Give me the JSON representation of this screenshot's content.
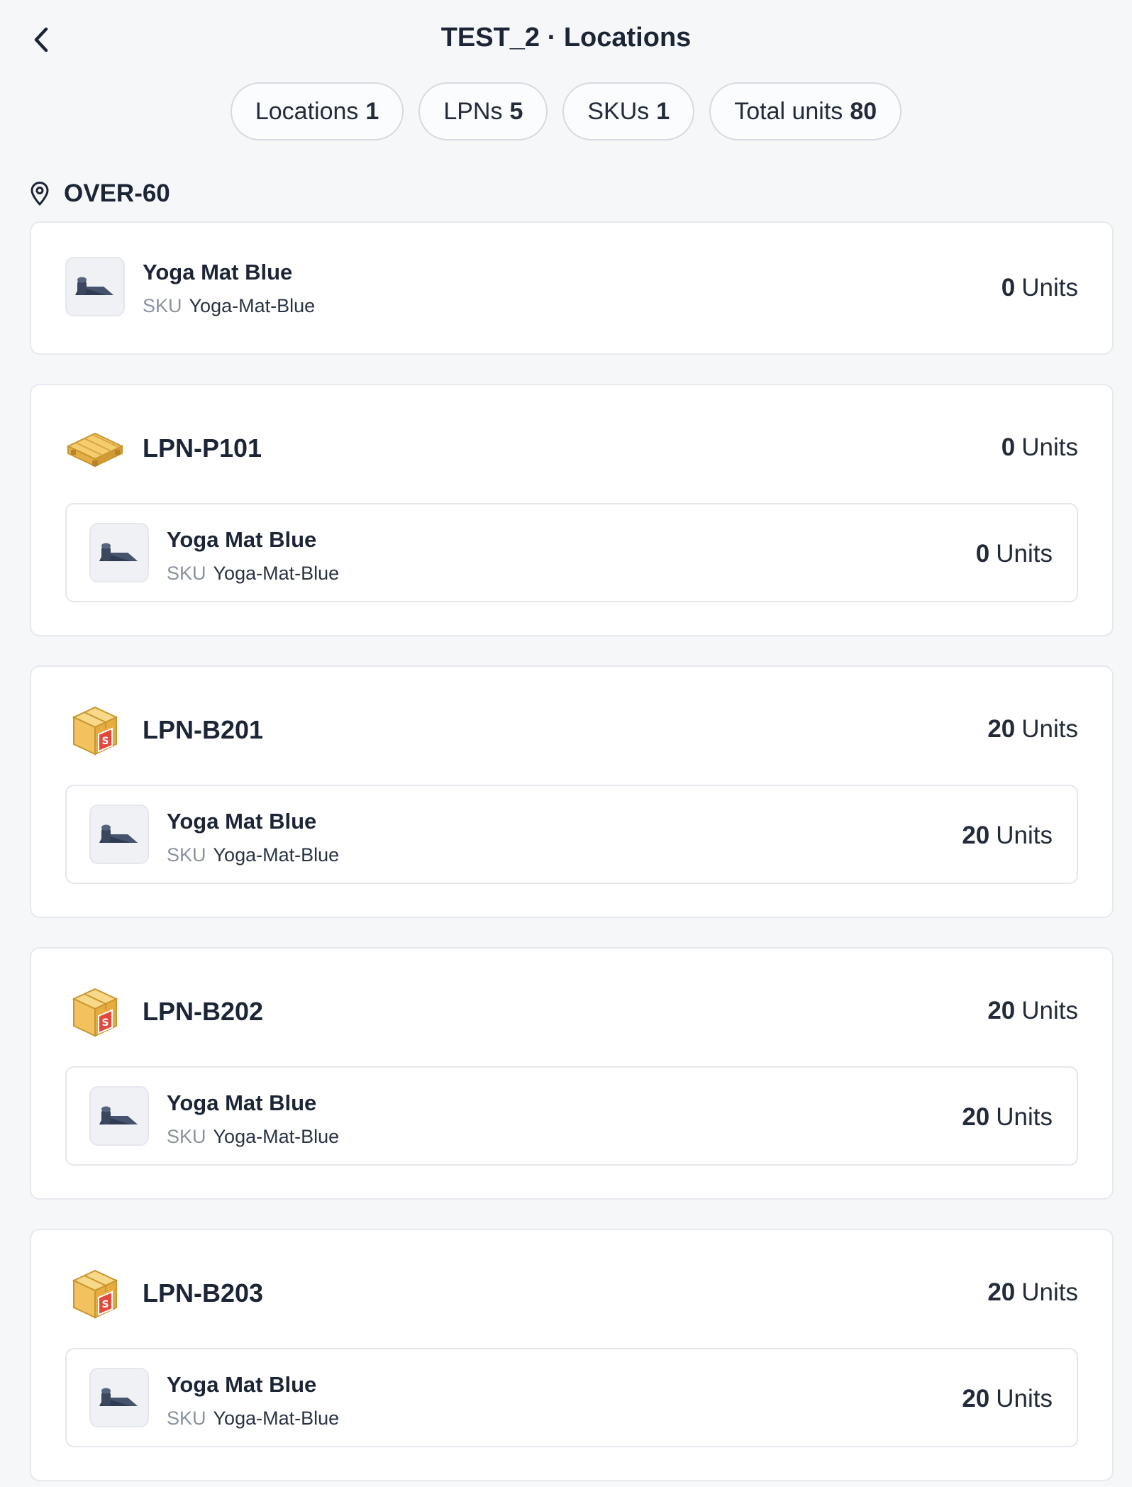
{
  "header": {
    "title": "TEST_2 · Locations"
  },
  "stats": [
    {
      "label": "Locations",
      "value": "1"
    },
    {
      "label": "LPNs",
      "value": "5"
    },
    {
      "label": "SKUs",
      "value": "1"
    },
    {
      "label": "Total units",
      "value": "80"
    }
  ],
  "location": {
    "name": "OVER-60",
    "loose_item": {
      "name": "Yoga Mat Blue",
      "sku_label": "SKU",
      "sku": "Yoga-Mat-Blue",
      "qty": "0",
      "unit_label": "Units"
    },
    "lpns": [
      {
        "id": "LPN-P101",
        "type": "pallet",
        "qty": "0",
        "unit_label": "Units",
        "item": {
          "name": "Yoga Mat Blue",
          "sku_label": "SKU",
          "sku": "Yoga-Mat-Blue",
          "qty": "0",
          "unit_label": "Units"
        }
      },
      {
        "id": "LPN-B201",
        "type": "box",
        "qty": "20",
        "unit_label": "Units",
        "item": {
          "name": "Yoga Mat Blue",
          "sku_label": "SKU",
          "sku": "Yoga-Mat-Blue",
          "qty": "20",
          "unit_label": "Units"
        }
      },
      {
        "id": "LPN-B202",
        "type": "box",
        "qty": "20",
        "unit_label": "Units",
        "item": {
          "name": "Yoga Mat Blue",
          "sku_label": "SKU",
          "sku": "Yoga-Mat-Blue",
          "qty": "20",
          "unit_label": "Units"
        }
      },
      {
        "id": "LPN-B203",
        "type": "box",
        "qty": "20",
        "unit_label": "Units",
        "item": {
          "name": "Yoga Mat Blue",
          "sku_label": "SKU",
          "sku": "Yoga-Mat-Blue",
          "qty": "20",
          "unit_label": "Units"
        }
      }
    ]
  },
  "icons": {
    "back": "chevron-left-icon",
    "location": "map-pin-icon",
    "item_thumb": "yoga-mat-icon",
    "pallet": "pallet-icon",
    "box": "box-icon"
  },
  "colors": {
    "background": "#f6f7f9",
    "card": "#ffffff",
    "text": "#1c2536",
    "muted": "#8a92a0",
    "border": "#e4e7ec",
    "box_accent": "#f2c25f",
    "pallet_accent": "#f0c15a"
  }
}
